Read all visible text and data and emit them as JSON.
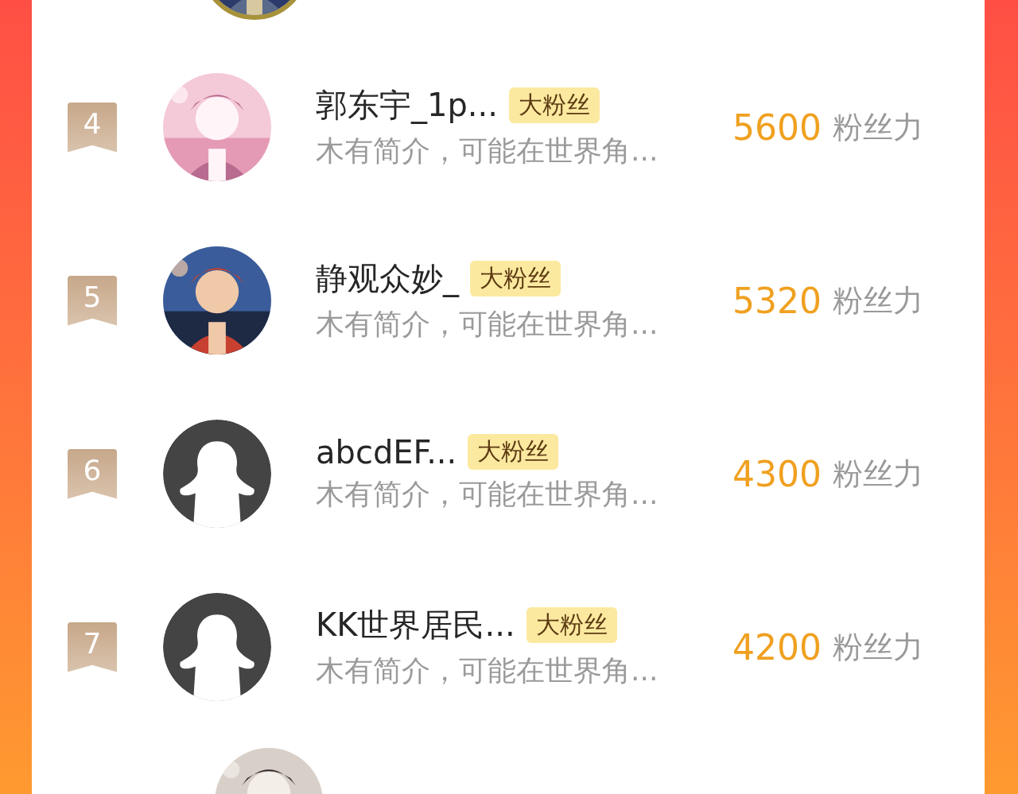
{
  "rows": [
    {
      "rank": "4",
      "name": "郭东宇_1p...",
      "badge": "大粉丝",
      "bio": "木有简介，可能在世界角...",
      "score": "5600",
      "score_label": "粉丝力"
    },
    {
      "rank": "5",
      "name": "静观众妙_",
      "badge": "大粉丝",
      "bio": "木有简介，可能在世界角...",
      "score": "5320",
      "score_label": "粉丝力"
    },
    {
      "rank": "6",
      "avatar": {
        "kind": "default"
      },
      "name": "abcdEF...",
      "badge": "大粉丝",
      "bio": "木有简介，可能在世界角...",
      "score": "4300",
      "score_label": "粉丝力"
    },
    {
      "rank": "7",
      "avatar": {
        "kind": "default"
      },
      "name": "KK世界居民...",
      "badge": "大粉丝",
      "bio": "木有简介，可能在世界角...",
      "score": "4200",
      "score_label": "粉丝力"
    }
  ]
}
